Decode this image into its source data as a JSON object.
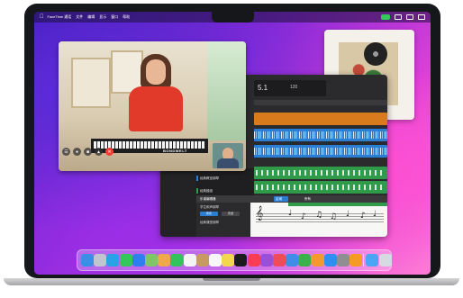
{
  "menubar": {
    "app_name": "FaceTime 通话",
    "items": [
      "文件",
      "编辑",
      "显示",
      "窗口",
      "帮助"
    ]
  },
  "garageband": {
    "lcd_bar": "5.1",
    "lcd_tempo": "120",
    "tracks": [
      {
        "name": "经典教室钢琴",
        "color": "#2a7fd4"
      },
      {
        "name": "经典鼓组",
        "color": "#2e9a4a"
      }
    ],
    "score": {
      "toolbar_left": "乐谱编辑器",
      "toolbar_mid": "区域",
      "toolbar_right": "所有",
      "region_title": "学生和声钢琴",
      "btn_primary": "所有",
      "btn_secondary": "乐谱",
      "instrument_label": "经典课堂钢琴"
    }
  },
  "facetime": {
    "keyboard_brand": "BONDWELT"
  },
  "dock": {
    "apps": [
      {
        "icon": "finder-icon",
        "color": "#3a8ee6"
      },
      {
        "icon": "launchpad-icon",
        "color": "#c0c6d0"
      },
      {
        "icon": "safari-icon",
        "color": "#2aa2e6"
      },
      {
        "icon": "messages-icon",
        "color": "#34c759"
      },
      {
        "icon": "mail-icon",
        "color": "#2f7ef0"
      },
      {
        "icon": "maps-icon",
        "color": "#7fc56a"
      },
      {
        "icon": "photos-icon",
        "color": "#f1a84a"
      },
      {
        "icon": "facetime-icon",
        "color": "#32c45a"
      },
      {
        "icon": "calendar-icon",
        "color": "#f4f4f4"
      },
      {
        "icon": "contacts-icon",
        "color": "#c79a64"
      },
      {
        "icon": "reminders-icon",
        "color": "#f7f7f7"
      },
      {
        "icon": "notes-icon",
        "color": "#f4d54e"
      },
      {
        "icon": "tv-icon",
        "color": "#1c1c1e"
      },
      {
        "icon": "music-icon",
        "color": "#fa3d55"
      },
      {
        "icon": "podcasts-icon",
        "color": "#9a4fd8"
      },
      {
        "icon": "news-icon",
        "color": "#f04b5a"
      },
      {
        "icon": "keynote-icon",
        "color": "#3e8de6"
      },
      {
        "icon": "numbers-icon",
        "color": "#3ab14a"
      },
      {
        "icon": "pages-icon",
        "color": "#f39a2e"
      },
      {
        "icon": "appstore-icon",
        "color": "#2f8ff0"
      },
      {
        "icon": "settings-icon",
        "color": "#8e8e93"
      },
      {
        "icon": "garageband-icon",
        "color": "#f59a23"
      },
      {
        "icon": "downloads-icon",
        "color": "#4aa6f4"
      },
      {
        "icon": "trash-icon",
        "color": "#d6dbe2"
      }
    ]
  }
}
